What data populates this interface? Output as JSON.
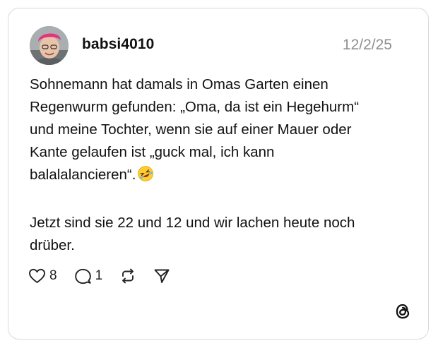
{
  "post": {
    "username": "babsi4010",
    "date": "12/2/25",
    "text_line1": "Sohnemann hat damals in Omas Garten einen",
    "text_line2": "Regenwurm gefunden: „Oma, da ist ein Hegehurm“",
    "text_line3": "und meine Tochter, wenn sie auf einer Mauer oder",
    "text_line4": "Kante gelaufen ist „guck mal, ich kann",
    "text_line5": "balalalancieren“.",
    "text_line6": "Jetzt sind sie 22 und 12 und wir lachen heute noch",
    "text_line7": "drüber.",
    "emoji": "rolling-on-floor-laughing-emoji",
    "avatar": "user-avatar-photo"
  },
  "actions": {
    "like_icon": "heart-icon",
    "like_count": "8",
    "reply_icon": "comment-icon",
    "reply_count": "1",
    "repost_icon": "repost-icon",
    "share_icon": "send-icon"
  },
  "brand": {
    "logo": "threads-logo",
    "accent_colors": {
      "text": "#111111",
      "muted": "#8f8f8f",
      "border": "#d9d9d9"
    }
  }
}
